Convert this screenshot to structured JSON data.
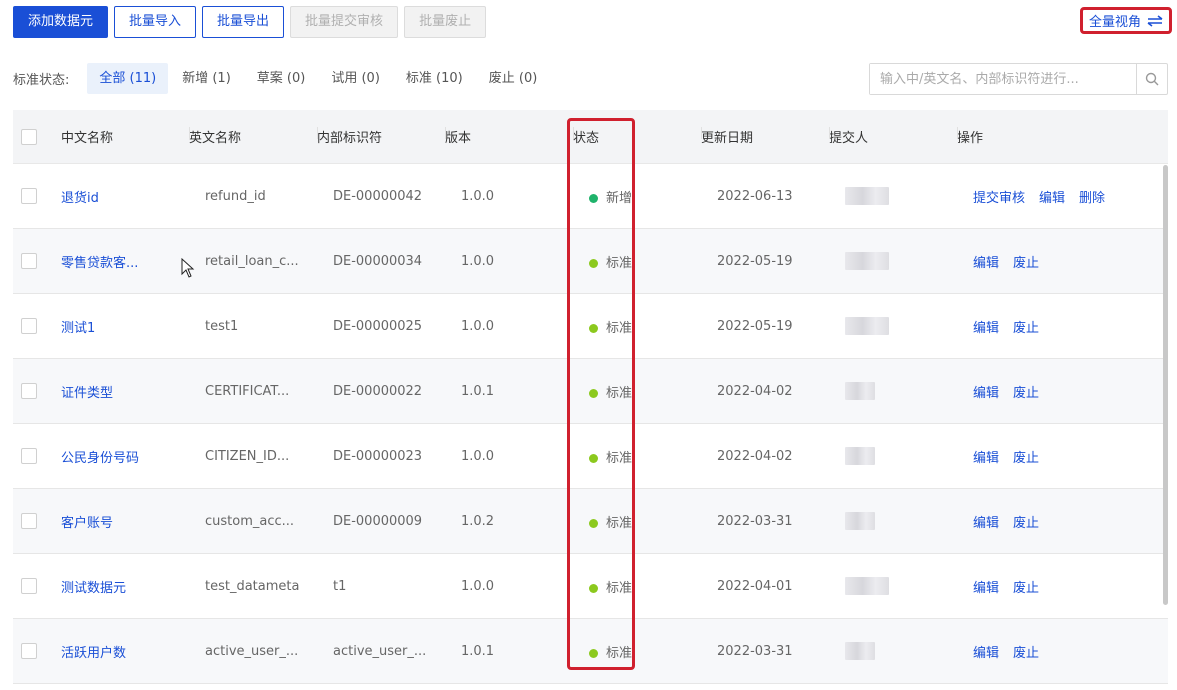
{
  "toolbar": {
    "add_label": "添加数据元",
    "import_label": "批量导入",
    "export_label": "批量导出",
    "submit_review_label": "批量提交审核",
    "deprecate_label": "批量废止"
  },
  "view_toggle": {
    "label": "全量视角",
    "icon": "swap-arrows-icon"
  },
  "filter": {
    "label": "标准状态:",
    "tabs": [
      {
        "label": "全部 (11)",
        "active": true
      },
      {
        "label": "新增 (1)"
      },
      {
        "label": "草案 (0)"
      },
      {
        "label": "试用 (0)"
      },
      {
        "label": "标准 (10)"
      },
      {
        "label": "废止 (0)"
      }
    ]
  },
  "search": {
    "placeholder": "输入中/英文名、内部标识符进行...",
    "icon": "search-icon"
  },
  "table": {
    "headers": {
      "cn_name": "中文名称",
      "en_name": "英文名称",
      "internal_id": "内部标识符",
      "version": "版本",
      "status": "状态",
      "updated": "更新日期",
      "submitter": "提交人",
      "actions": "操作"
    },
    "rows": [
      {
        "cn_name": "退货id",
        "en_name": "refund_id",
        "internal_id": "DE-00000042",
        "version": "1.0.0",
        "status": "新增",
        "status_color": "#1fb36b",
        "updated": "2022-06-13",
        "actions": [
          "提交审核",
          "编辑",
          "删除"
        ]
      },
      {
        "cn_name": "零售贷款客...",
        "en_name": "retail_loan_c...",
        "internal_id": "DE-00000034",
        "version": "1.0.0",
        "status": "标准",
        "status_color": "#8cc91e",
        "updated": "2022-05-19",
        "actions": [
          "编辑",
          "废止"
        ]
      },
      {
        "cn_name": "测试1",
        "en_name": "test1",
        "internal_id": "DE-00000025",
        "version": "1.0.0",
        "status": "标准",
        "status_color": "#8cc91e",
        "updated": "2022-05-19",
        "actions": [
          "编辑",
          "废止"
        ]
      },
      {
        "cn_name": "证件类型",
        "en_name": "CERTIFICAT...",
        "internal_id": "DE-00000022",
        "version": "1.0.1",
        "status": "标准",
        "status_color": "#8cc91e",
        "updated": "2022-04-02",
        "actions": [
          "编辑",
          "废止"
        ]
      },
      {
        "cn_name": "公民身份号码",
        "en_name": "CITIZEN_ID...",
        "internal_id": "DE-00000023",
        "version": "1.0.0",
        "status": "标准",
        "status_color": "#8cc91e",
        "updated": "2022-04-02",
        "actions": [
          "编辑",
          "废止"
        ]
      },
      {
        "cn_name": "客户账号",
        "en_name": "custom_acc...",
        "internal_id": "DE-00000009",
        "version": "1.0.2",
        "status": "标准",
        "status_color": "#8cc91e",
        "updated": "2022-03-31",
        "actions": [
          "编辑",
          "废止"
        ]
      },
      {
        "cn_name": "测试数据元",
        "en_name": "test_datameta",
        "internal_id": "t1",
        "version": "1.0.0",
        "status": "标准",
        "status_color": "#8cc91e",
        "updated": "2022-04-01",
        "actions": [
          "编辑",
          "废止"
        ]
      },
      {
        "cn_name": "活跃用户数",
        "en_name": "active_user_...",
        "internal_id": "active_user_...",
        "version": "1.0.1",
        "status": "标准",
        "status_color": "#8cc91e",
        "updated": "2022-03-31",
        "actions": [
          "编辑",
          "废止"
        ]
      }
    ]
  },
  "colors": {
    "primary": "#1a4fd6",
    "highlight": "#d0202e"
  }
}
